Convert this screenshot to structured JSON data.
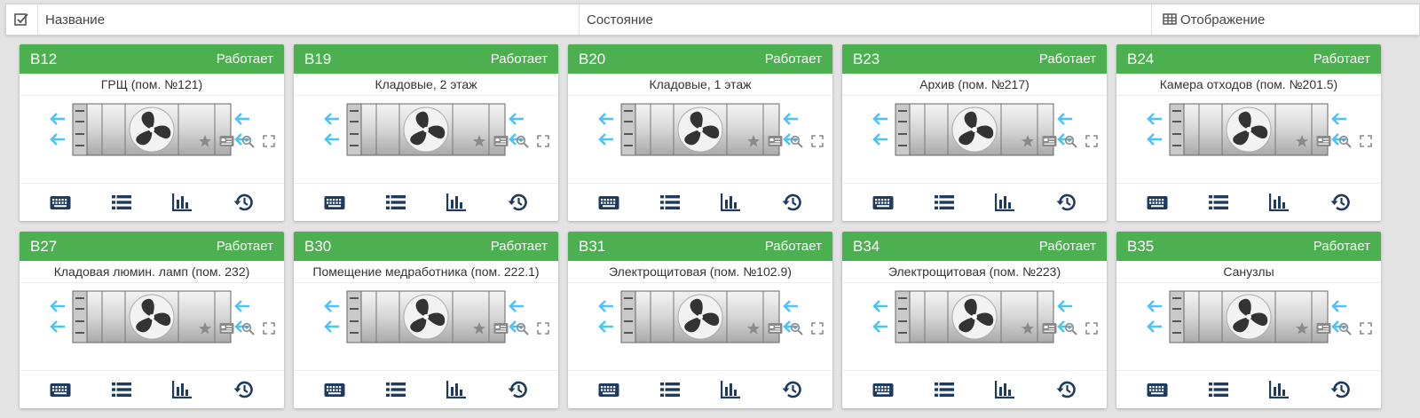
{
  "header": {
    "col_name": "Название",
    "col_state": "Состояние",
    "col_display": "Отображение"
  },
  "colors": {
    "accent": "#4caf50",
    "arrow": "#4fc3f7"
  },
  "icons": {
    "header": [
      "checklist-icon",
      "table-grid-icon"
    ],
    "card_tools": [
      "star-icon",
      "card-icon",
      "zoom-icon",
      "expand-icon"
    ],
    "card_actions": [
      "keyboard-icon",
      "list-icon",
      "bar-chart-icon",
      "history-icon"
    ]
  },
  "cards": [
    {
      "id": "В12",
      "state": "Работает",
      "title": "ГРЩ (пом. №121)"
    },
    {
      "id": "В19",
      "state": "Работает",
      "title": "Кладовые, 2 этаж"
    },
    {
      "id": "В20",
      "state": "Работает",
      "title": "Кладовые, 1 этаж"
    },
    {
      "id": "В23",
      "state": "Работает",
      "title": "Архив (пом. №217)"
    },
    {
      "id": "В24",
      "state": "Работает",
      "title": "Камера отходов (пом. №201.5)"
    },
    {
      "id": "В27",
      "state": "Работает",
      "title": "Кладовая люмин. ламп (пом. 232)"
    },
    {
      "id": "В30",
      "state": "Работает",
      "title": "Помещение медработника (пом. 222.1)"
    },
    {
      "id": "В31",
      "state": "Работает",
      "title": "Электрощитовая (пом. №102.9)"
    },
    {
      "id": "В34",
      "state": "Работает",
      "title": "Электрощитовая (пом. №223)"
    },
    {
      "id": "В35",
      "state": "Работает",
      "title": "Санузлы"
    }
  ]
}
